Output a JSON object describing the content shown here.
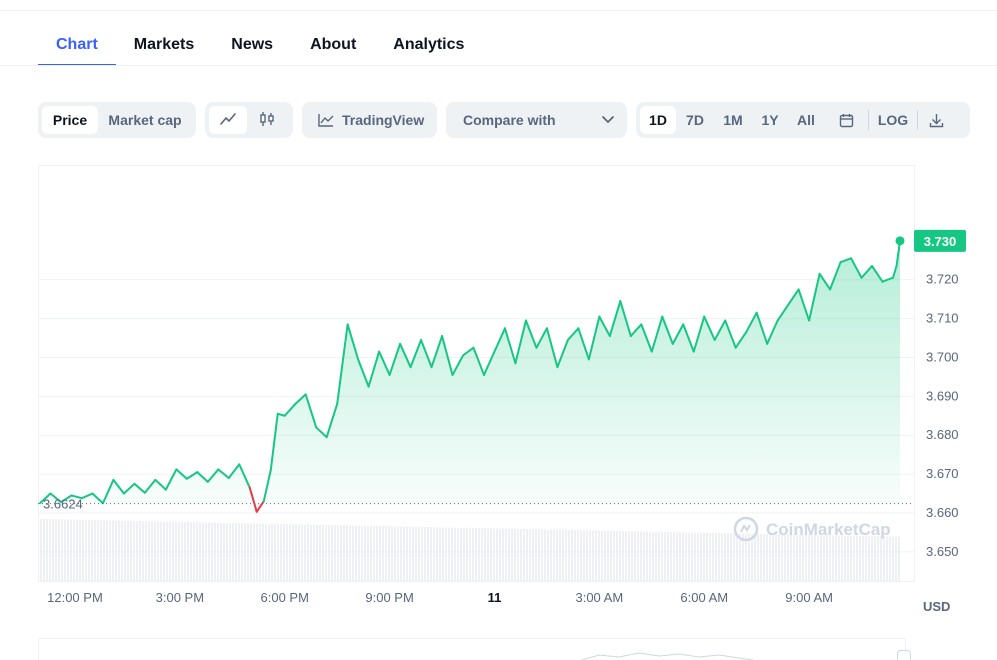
{
  "tabs": [
    {
      "label": "Chart",
      "active": true
    },
    {
      "label": "Markets",
      "active": false
    },
    {
      "label": "News",
      "active": false
    },
    {
      "label": "About",
      "active": false
    },
    {
      "label": "Analytics",
      "active": false
    }
  ],
  "toolbar": {
    "price_label": "Price",
    "market_cap_label": "Market cap",
    "line_icon": "line-chart-icon",
    "candle_icon": "candlestick-icon",
    "tradingview_label": "TradingView",
    "compare_label": "Compare with",
    "ranges": [
      "1D",
      "7D",
      "1M",
      "1Y",
      "All"
    ],
    "active_range": "1D",
    "calendar_icon": "calendar-icon",
    "log_label": "LOG",
    "download_icon": "download-icon"
  },
  "colors": {
    "accent": "#3861fb",
    "up": "#16c784",
    "down": "#ea3943",
    "axis": "#58667e"
  },
  "chart_data": {
    "type": "area",
    "currency": "USD",
    "watermark": "CoinMarketCap",
    "open_price_label": "3.6624",
    "open_price": 3.6624,
    "current_price_label": "3.730",
    "current_price": 3.73,
    "y_ticks": [
      "3.720",
      "3.710",
      "3.700",
      "3.690",
      "3.680",
      "3.670",
      "3.660",
      "3.650"
    ],
    "ylim": [
      3.6425,
      3.7495
    ],
    "x_ticks": [
      "12:00 PM",
      "3:00 PM",
      "6:00 PM",
      "9:00 PM",
      "11",
      "3:00 AM",
      "6:00 AM",
      "9:00 AM"
    ],
    "x_ticks_bold": [
      false,
      false,
      false,
      false,
      true,
      false,
      false,
      false
    ],
    "x_tick_hours": [
      12,
      15,
      18,
      21,
      24,
      27,
      30,
      33
    ],
    "xlim": [
      11,
      35.6
    ],
    "grid": true,
    "series": [
      {
        "x": [
          11.0,
          11.3,
          11.6,
          11.9,
          12.2,
          12.5,
          12.8,
          13.1,
          13.4,
          13.7,
          14.0,
          14.3,
          14.6,
          14.9,
          15.2,
          15.5,
          15.8,
          16.1,
          16.4,
          16.7,
          17.0,
          17.2,
          17.4,
          17.6,
          17.8,
          18.0,
          18.3,
          18.6,
          18.9,
          19.2,
          19.5,
          19.8,
          20.1,
          20.4,
          20.7,
          21.0,
          21.3,
          21.6,
          21.9,
          22.2,
          22.5,
          22.8,
          23.1,
          23.4,
          23.7,
          24.0,
          24.3,
          24.6,
          24.9,
          25.2,
          25.5,
          25.8,
          26.1,
          26.4,
          26.7,
          27.0,
          27.3,
          27.6,
          27.9,
          28.2,
          28.5,
          28.8,
          29.1,
          29.4,
          29.7,
          30.0,
          30.3,
          30.6,
          30.9,
          31.2,
          31.5,
          31.8,
          32.1,
          32.4,
          32.7,
          33.0,
          33.3,
          33.6,
          33.9,
          34.2,
          34.5,
          34.8,
          35.1,
          35.4,
          35.5,
          35.6
        ],
        "y": [
          3.6625,
          3.665,
          3.6628,
          3.6645,
          3.6638,
          3.665,
          3.6625,
          3.6685,
          3.665,
          3.6675,
          3.6652,
          3.6685,
          3.666,
          3.6712,
          3.6688,
          3.6705,
          3.668,
          3.6712,
          3.669,
          3.6725,
          3.6665,
          3.6603,
          3.663,
          3.671,
          3.6855,
          3.685,
          3.688,
          3.6905,
          3.682,
          3.6795,
          3.688,
          3.7085,
          3.6995,
          3.6925,
          3.7015,
          3.6955,
          3.7035,
          3.6975,
          3.7045,
          3.6975,
          3.7055,
          3.6955,
          3.7005,
          3.7025,
          3.6955,
          3.7015,
          3.7075,
          3.6985,
          3.7095,
          3.7025,
          3.7075,
          3.6975,
          3.7045,
          3.7075,
          3.6995,
          3.7105,
          3.7055,
          3.7145,
          3.7055,
          3.7085,
          3.7015,
          3.7105,
          3.7035,
          3.7085,
          3.7015,
          3.7105,
          3.7045,
          3.7095,
          3.7025,
          3.7065,
          3.7115,
          3.7035,
          3.7095,
          3.7135,
          3.7175,
          3.7095,
          3.7215,
          3.7175,
          3.7245,
          3.7255,
          3.7205,
          3.7235,
          3.7195,
          3.7205,
          3.7235,
          3.73
        ]
      }
    ]
  }
}
